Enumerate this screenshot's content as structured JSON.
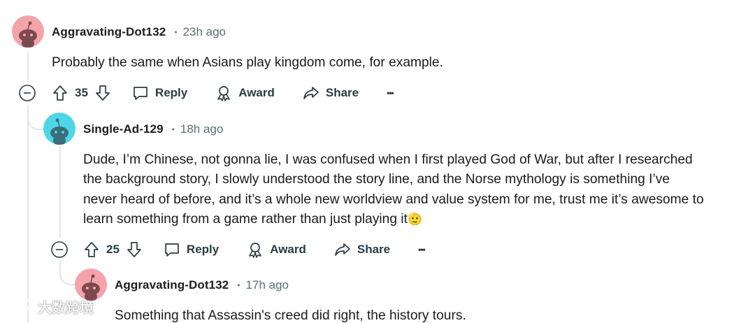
{
  "comments": [
    {
      "username": "Aggravating-Dot132",
      "separator": "•",
      "time": "23h ago",
      "body": "Probably the same when Asians play kingdom come, for example.",
      "votes": "35",
      "reply_label": "Reply",
      "award_label": "Award",
      "share_label": "Share",
      "more_label": "•••",
      "avatar_color": "#f4a3aa"
    },
    {
      "username": "Single-Ad-129",
      "separator": "•",
      "time": "18h ago",
      "body_lines": [
        "Dude, I’m Chinese, not gonna lie, I was confused when I first played God of War, but after I researched",
        "the background story, I slowly understood the story line, and the Norse mythology is something I’ve",
        "never heard of before, and it’s a whole new worldview and value system for me, trust me it’s awesome to",
        "learn something from a game rather than just playing it"
      ],
      "emoji": "🫡",
      "votes": "25",
      "reply_label": "Reply",
      "award_label": "Award",
      "share_label": "Share",
      "more_label": "•••",
      "avatar_color": "#4fd6e6"
    },
    {
      "username": "Aggravating-Dot132",
      "separator": "•",
      "time": "17h ago",
      "body": "Something that Assassin's creed did right, the history tours.",
      "avatar_color": "#f4a3aa"
    }
  ],
  "icons": {
    "collapse": "minus-circle-icon",
    "upvote": "arrow-up-icon",
    "downvote": "arrow-down-icon",
    "reply": "speech-bubble-icon",
    "award": "award-icon",
    "share": "share-arrow-icon",
    "more": "ellipsis-icon"
  },
  "watermark": {
    "text": "大数跨境"
  }
}
